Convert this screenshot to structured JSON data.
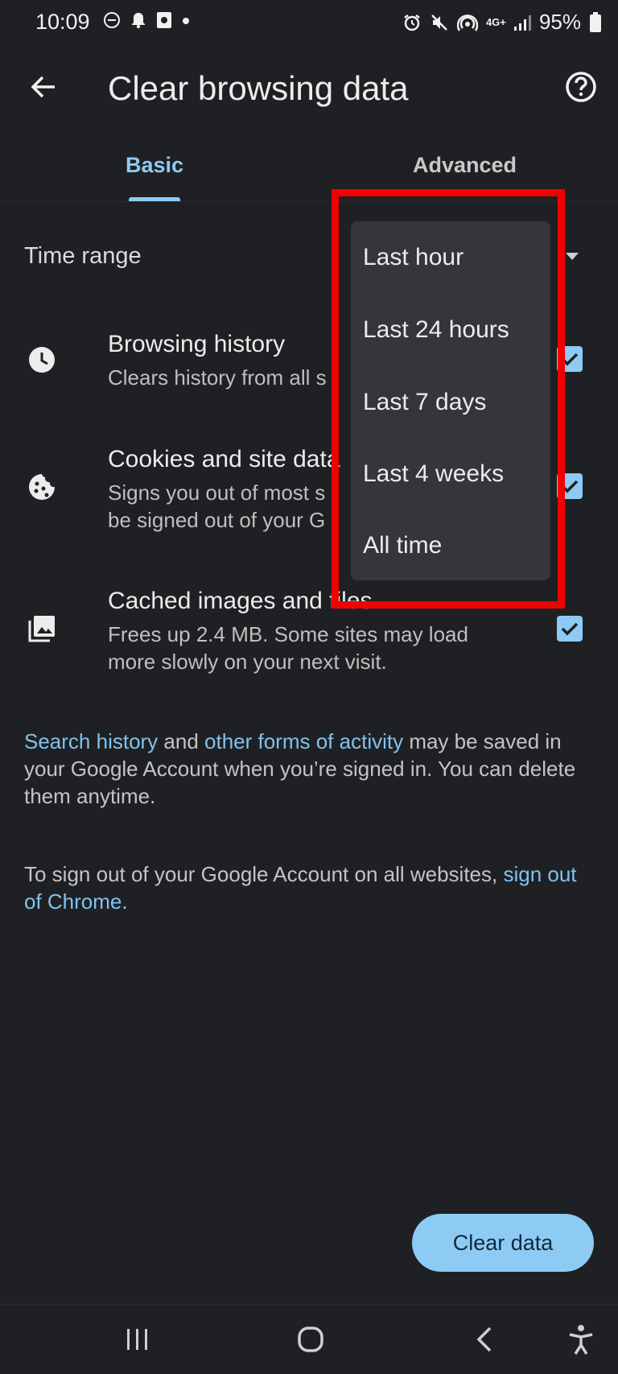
{
  "status_bar": {
    "time": "10:09",
    "battery": "95%",
    "network": "4G+",
    "left_icons": [
      "do-not-disturb-icon",
      "notification-bell-icon",
      "app-notification-icon",
      "dot-icon"
    ],
    "right_icons": [
      "alarm-icon",
      "mute-icon",
      "hotspot-icon",
      "signal-icon",
      "battery-icon"
    ]
  },
  "app_bar": {
    "title": "Clear browsing data"
  },
  "tabs": [
    {
      "label": "Basic",
      "selected": true
    },
    {
      "label": "Advanced",
      "selected": false
    }
  ],
  "time_range": {
    "label": "Time range",
    "options": [
      "Last hour",
      "Last 24 hours",
      "Last 7 days",
      "Last 4 weeks",
      "All time"
    ]
  },
  "items": [
    {
      "title": "Browsing history",
      "subtitle": "Clears history from all s",
      "checked": true,
      "icon": "clock-icon"
    },
    {
      "title": "Cookies and site data",
      "subtitle_lines": [
        "Signs you out of most s",
        "be signed out of your G"
      ],
      "checked": true,
      "icon": "cookie-icon"
    },
    {
      "title": "Cached images and files",
      "subtitle_lines": [
        "Frees up 2.4 MB. Some sites may load",
        "more slowly on your next visit."
      ],
      "checked": true,
      "icon": "image-icon"
    }
  ],
  "info1": {
    "link1": "Search history",
    "mid": " and ",
    "link2": "other forms of activity",
    "rest": " may be saved in your Google Account when you’re signed in. You can delete them anytime."
  },
  "info2": {
    "text": "To sign out of your Google Account on all websites, ",
    "link": "sign out of Chrome",
    "end": "."
  },
  "clear_button": "Clear data",
  "colors": {
    "background": "#1f2023",
    "accent": "#8ecbf4",
    "link": "#7fc2f0",
    "menu": "#35363a",
    "highlight": "#f00000"
  }
}
